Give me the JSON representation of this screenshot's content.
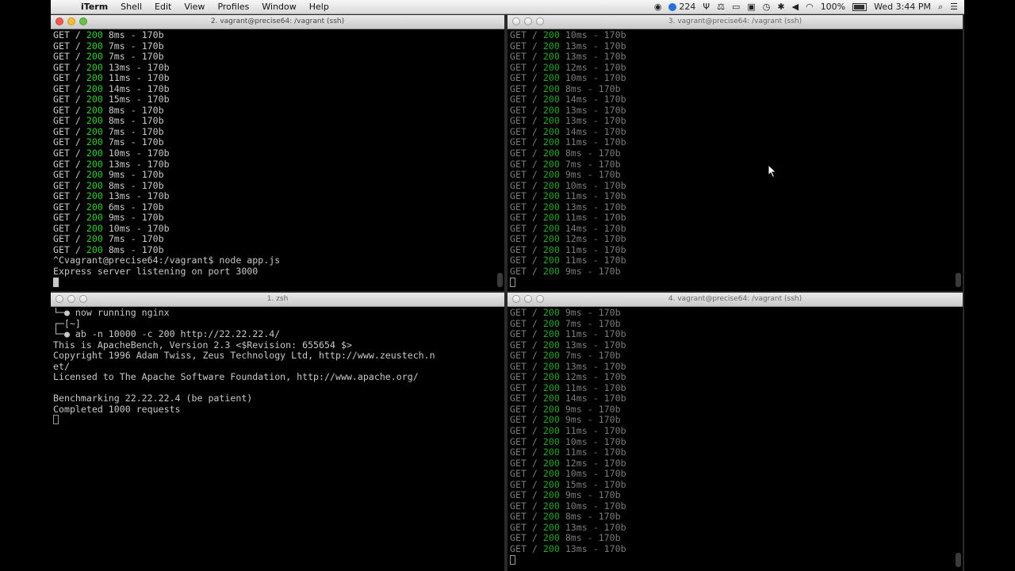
{
  "menubar": {
    "app_name": "iTerm",
    "items": [
      "Shell",
      "Edit",
      "View",
      "Profiles",
      "Window",
      "Help"
    ],
    "tray": {
      "notification_count": "224",
      "battery": "100%",
      "clock": "Wed 3:44 PM"
    }
  },
  "windows": {
    "tl": {
      "title": "2. vagrant@precise64: /vagrant (ssh)",
      "lines": [
        [
          "GET / ",
          "200",
          " 8ms - 170b"
        ],
        [
          "GET / ",
          "200",
          " 7ms - 170b"
        ],
        [
          "GET / ",
          "200",
          " 7ms - 170b"
        ],
        [
          "GET / ",
          "200",
          " 13ms - 170b"
        ],
        [
          "GET / ",
          "200",
          " 11ms - 170b"
        ],
        [
          "GET / ",
          "200",
          " 14ms - 170b"
        ],
        [
          "GET / ",
          "200",
          " 15ms - 170b"
        ],
        [
          "GET / ",
          "200",
          " 8ms - 170b"
        ],
        [
          "GET / ",
          "200",
          " 8ms - 170b"
        ],
        [
          "GET / ",
          "200",
          " 7ms - 170b"
        ],
        [
          "GET / ",
          "200",
          " 7ms - 170b"
        ],
        [
          "GET / ",
          "200",
          " 10ms - 170b"
        ],
        [
          "GET / ",
          "200",
          " 13ms - 170b"
        ],
        [
          "GET / ",
          "200",
          " 9ms - 170b"
        ],
        [
          "GET / ",
          "200",
          " 8ms - 170b"
        ],
        [
          "GET / ",
          "200",
          " 13ms - 170b"
        ],
        [
          "GET / ",
          "200",
          " 6ms - 170b"
        ],
        [
          "GET / ",
          "200",
          " 9ms - 170b"
        ],
        [
          "GET / ",
          "200",
          " 10ms - 170b"
        ],
        [
          "GET / ",
          "200",
          " 7ms - 170b"
        ],
        [
          "GET / ",
          "200",
          " 8ms - 170b"
        ],
        [
          "^Cvagrant@precise64:/vagrant$ node app.js"
        ],
        [
          "Express server listening on port 3000"
        ]
      ]
    },
    "tr": {
      "title": "3. vagrant@precise64: /vagrant (ssh)",
      "lines": [
        [
          "GET / ",
          "200",
          " 10ms - 170b"
        ],
        [
          "GET / ",
          "200",
          " 13ms - 170b"
        ],
        [
          "GET / ",
          "200",
          " 13ms - 170b"
        ],
        [
          "GET / ",
          "200",
          " 12ms - 170b"
        ],
        [
          "GET / ",
          "200",
          " 10ms - 170b"
        ],
        [
          "GET / ",
          "200",
          " 8ms - 170b"
        ],
        [
          "GET / ",
          "200",
          " 14ms - 170b"
        ],
        [
          "GET / ",
          "200",
          " 13ms - 170b"
        ],
        [
          "GET / ",
          "200",
          " 13ms - 170b"
        ],
        [
          "GET / ",
          "200",
          " 14ms - 170b"
        ],
        [
          "GET / ",
          "200",
          " 11ms - 170b"
        ],
        [
          "GET / ",
          "200",
          " 8ms - 170b"
        ],
        [
          "GET / ",
          "200",
          " 7ms - 170b"
        ],
        [
          "GET / ",
          "200",
          " 9ms - 170b"
        ],
        [
          "GET / ",
          "200",
          " 10ms - 170b"
        ],
        [
          "GET / ",
          "200",
          " 11ms - 170b"
        ],
        [
          "GET / ",
          "200",
          " 13ms - 170b"
        ],
        [
          "GET / ",
          "200",
          " 11ms - 170b"
        ],
        [
          "GET / ",
          "200",
          " 14ms - 170b"
        ],
        [
          "GET / ",
          "200",
          " 12ms - 170b"
        ],
        [
          "GET / ",
          "200",
          " 11ms - 170b"
        ],
        [
          "GET / ",
          "200",
          " 11ms - 170b"
        ],
        [
          "GET / ",
          "200",
          " 9ms - 170b"
        ]
      ]
    },
    "bl": {
      "title": "1. zsh",
      "lines": [
        [
          "└─● now running nginx"
        ],
        [
          "┌─[~]"
        ],
        [
          "└─● ab -n 10000 -c 200 http://22.22.22.4/"
        ],
        [
          "This is ApacheBench, Version 2.3 <$Revision: 655654 $>"
        ],
        [
          "Copyright 1996 Adam Twiss, Zeus Technology Ltd, http://www.zeustech.n"
        ],
        [
          "et/"
        ],
        [
          "Licensed to The Apache Software Foundation, http://www.apache.org/"
        ],
        [
          ""
        ],
        [
          "Benchmarking 22.22.22.4 (be patient)"
        ],
        [
          "Completed 1000 requests"
        ]
      ]
    },
    "br": {
      "title": "4. vagrant@precise64: /vagrant (ssh)",
      "lines": [
        [
          "GET / ",
          "200",
          " 9ms - 170b"
        ],
        [
          "GET / ",
          "200",
          " 7ms - 170b"
        ],
        [
          "GET / ",
          "200",
          " 11ms - 170b"
        ],
        [
          "GET / ",
          "200",
          " 13ms - 170b"
        ],
        [
          "GET / ",
          "200",
          " 7ms - 170b"
        ],
        [
          "GET / ",
          "200",
          " 13ms - 170b"
        ],
        [
          "GET / ",
          "200",
          " 12ms - 170b"
        ],
        [
          "GET / ",
          "200",
          " 11ms - 170b"
        ],
        [
          "GET / ",
          "200",
          " 14ms - 170b"
        ],
        [
          "GET / ",
          "200",
          " 9ms - 170b"
        ],
        [
          "GET / ",
          "200",
          " 9ms - 170b"
        ],
        [
          "GET / ",
          "200",
          " 11ms - 170b"
        ],
        [
          "GET / ",
          "200",
          " 10ms - 170b"
        ],
        [
          "GET / ",
          "200",
          " 11ms - 170b"
        ],
        [
          "GET / ",
          "200",
          " 12ms - 170b"
        ],
        [
          "GET / ",
          "200",
          " 10ms - 170b"
        ],
        [
          "GET / ",
          "200",
          " 15ms - 170b"
        ],
        [
          "GET / ",
          "200",
          " 9ms - 170b"
        ],
        [
          "GET / ",
          "200",
          " 10ms - 170b"
        ],
        [
          "GET / ",
          "200",
          " 8ms - 170b"
        ],
        [
          "GET / ",
          "200",
          " 13ms - 170b"
        ],
        [
          "GET / ",
          "200",
          " 8ms - 170b"
        ],
        [
          "GET / ",
          "200",
          " 13ms - 170b"
        ]
      ]
    }
  }
}
